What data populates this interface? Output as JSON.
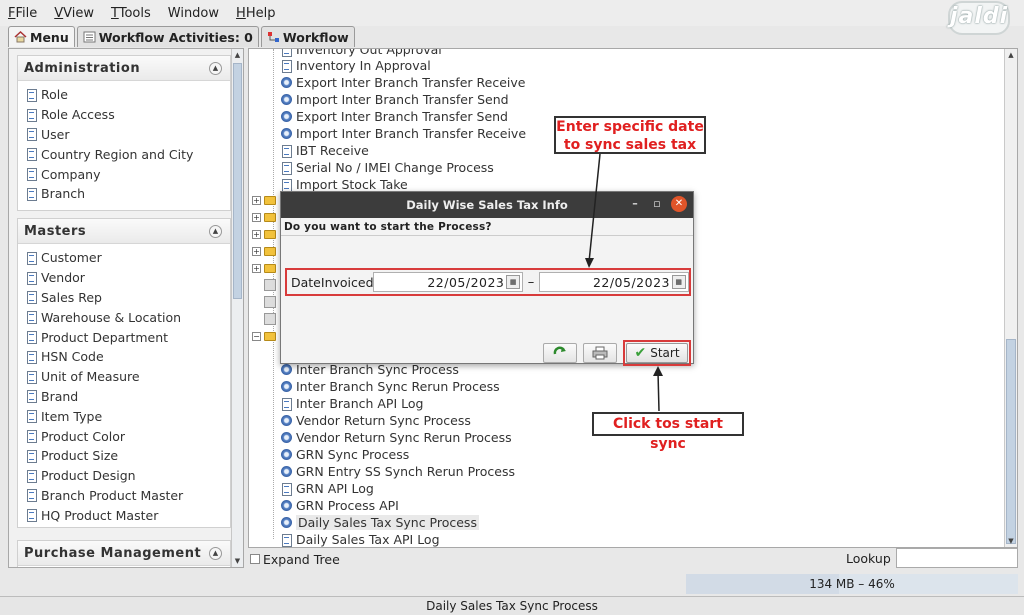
{
  "menu": [
    "File",
    "View",
    "Tools",
    "Window",
    "Help"
  ],
  "menu_mnemonic": [
    "F",
    "V",
    "T",
    "",
    "H"
  ],
  "logo_text": "jaldi",
  "tabs": [
    {
      "label": "Menu",
      "icon": "home-icon"
    },
    {
      "label": "Workflow Activities: 0",
      "icon": "list-icon"
    },
    {
      "label": "Workflow",
      "icon": "workflow-icon"
    }
  ],
  "sections": [
    {
      "title": "Administration",
      "items": [
        "Role",
        "Role Access",
        "User",
        "Country Region and City",
        "Company",
        "Branch"
      ]
    },
    {
      "title": "Masters",
      "items": [
        "Customer",
        "Vendor",
        "Sales Rep",
        "Warehouse & Location",
        "Product Department",
        "HSN Code",
        "Unit of Measure",
        "Brand",
        "Item Type",
        "Product Color",
        "Product Size",
        "Product Design",
        "Branch Product Master",
        "HQ Product Master"
      ]
    },
    {
      "title": "Purchase Management",
      "items": []
    }
  ],
  "tree_top": [
    {
      "label": "Inventory Out Approval",
      "icon": "doc"
    },
    {
      "label": "Inventory In Approval",
      "icon": "doc"
    },
    {
      "label": "Export Inter Branch Transfer Receive",
      "icon": "gear"
    },
    {
      "label": "Import Inter Branch Transfer Send",
      "icon": "gear"
    },
    {
      "label": "Export Inter Branch Transfer Send",
      "icon": "gear"
    },
    {
      "label": "Import Inter Branch Transfer Receive",
      "icon": "gear"
    },
    {
      "label": "IBT Receive",
      "icon": "doc"
    },
    {
      "label": "Serial No / IMEI Change Process",
      "icon": "doc"
    },
    {
      "label": "Import Stock Take",
      "icon": "doc"
    }
  ],
  "tree_bottom": [
    {
      "label": "Inter Branch Sync Process",
      "icon": "gear"
    },
    {
      "label": "Inter Branch Sync Rerun Process",
      "icon": "gear"
    },
    {
      "label": "Inter Branch API Log",
      "icon": "doc"
    },
    {
      "label": "Vendor Return Sync Process",
      "icon": "gear"
    },
    {
      "label": "Vendor Return Sync Rerun Process",
      "icon": "gear"
    },
    {
      "label": "GRN Sync Process",
      "icon": "gear"
    },
    {
      "label": "GRN Entry SS Synch Rerun Process",
      "icon": "gear"
    },
    {
      "label": "GRN API Log",
      "icon": "doc"
    },
    {
      "label": "GRN Process API",
      "icon": "gear"
    },
    {
      "label": "Daily Sales Tax Sync Process",
      "icon": "gear"
    },
    {
      "label": "Daily Sales Tax API Log",
      "icon": "doc"
    }
  ],
  "expand_tree": "Expand Tree",
  "lookup": {
    "label": "Lookup",
    "value": ""
  },
  "memory": {
    "text": "134 MB – 46%",
    "fraction": 0.46
  },
  "status": "Daily Sales Tax Sync Process",
  "dialog": {
    "title": "Daily Wise Sales Tax Info",
    "question": "Do you want to start the Process?",
    "date_label": "DateInvoiced",
    "date_from": "22/05/2023",
    "date_to": "22/05/2023",
    "separator": "–",
    "start_label": "Start"
  },
  "annotations": {
    "date_callout": "Enter specific date to sync sales tax",
    "start_callout": "Click tos start sync",
    "color": "#e02020"
  }
}
